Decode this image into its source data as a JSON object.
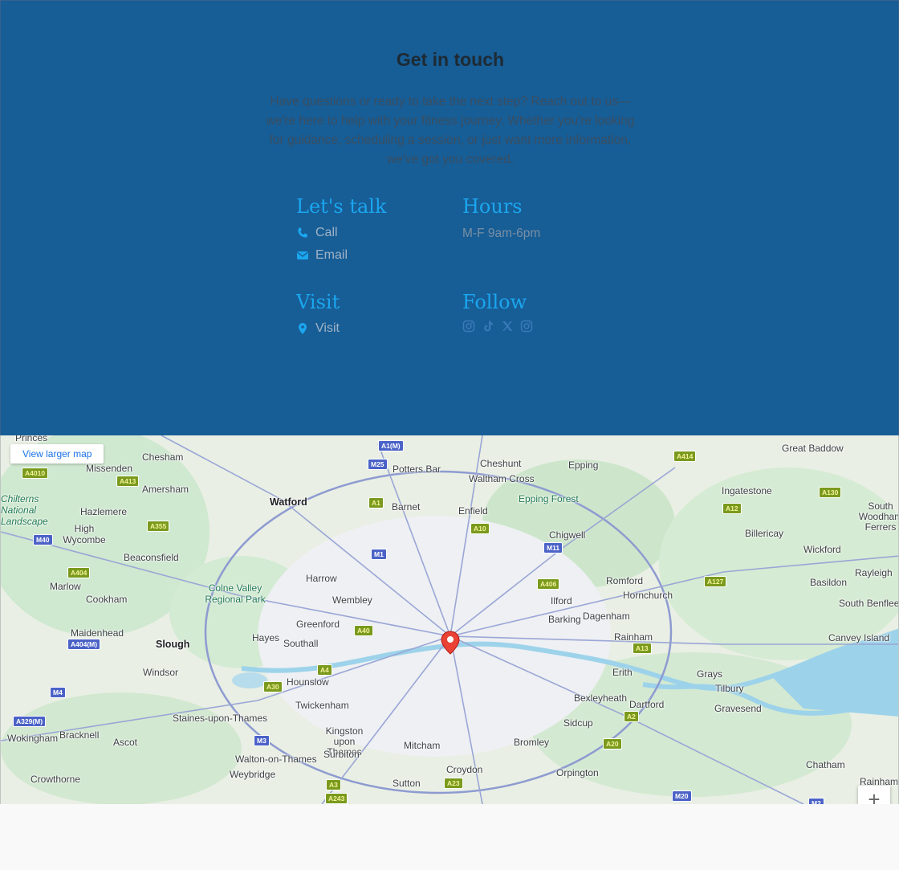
{
  "contact": {
    "title": "Get in touch",
    "intro": "Have questions or ready to take the next step? Reach out to us—we're here to help with your fitness journey. Whether you're looking for guidance, scheduling a session, or just want more information, we've got you covered.",
    "lets_talk": {
      "heading": "Let's talk",
      "call": "Call",
      "email": "Email"
    },
    "hours": {
      "heading": "Hours",
      "text": "M-F 9am-6pm"
    },
    "visit": {
      "heading": "Visit",
      "label": "Visit"
    },
    "follow": {
      "heading": "Follow",
      "icons": [
        "instagram-icon",
        "tiktok-icon",
        "x-icon",
        "instagram-icon"
      ]
    }
  },
  "map": {
    "larger_map": "View larger map",
    "zoom_in": "+",
    "places": [
      "Princes",
      "Chesham",
      "Missenden",
      "Amersham",
      "Potters Bar",
      "Cheshunt",
      "Epping",
      "Great Baddow",
      "Waltham Cross",
      "Watford",
      "Barnet",
      "Enfield",
      "Epping Forest",
      "Ingatestone",
      "Chilterns National Landscape",
      "Hazlemere",
      "High Wycombe",
      "Chigwell",
      "Billericay",
      "South Woodham Ferrers",
      "Beaconsfield",
      "Wickford",
      "Rayleigh",
      "Marlow",
      "Harrow",
      "Colne Valley Regional Park",
      "Romford",
      "Hornchurch",
      "Basildon",
      "Cookham",
      "Wembley",
      "Ilford",
      "South Benfleet",
      "Maidenhead",
      "Greenford",
      "Barking",
      "Dagenham",
      "Hayes",
      "Southall",
      "Rainham",
      "Canvey Island",
      "Slough",
      "Windsor",
      "Hounslow",
      "Erith",
      "Grays",
      "Tilbury",
      "Bexleyheath",
      "Dartford",
      "Gravesend",
      "Twickenham",
      "Staines-upon-Thames",
      "Wokingham",
      "Bracknell",
      "Ascot",
      "Kingston upon Thames",
      "Surbiton",
      "Mitcham",
      "Sidcup",
      "Bromley",
      "Walton-on-Thames",
      "Weybridge",
      "Croydon",
      "Orpington",
      "Chatham",
      "Crowthorne",
      "Sutton",
      "Rainham"
    ],
    "roads": [
      "A1(M)",
      "M25",
      "A4010",
      "A413",
      "A414",
      "A1",
      "A10",
      "A12",
      "A130",
      "A355",
      "M40",
      "M1",
      "M11",
      "A404",
      "A406",
      "A127",
      "A40",
      "A13",
      "A404(M)",
      "M4",
      "A30",
      "A4",
      "A2",
      "A329(M)",
      "M3",
      "A20",
      "A3",
      "A243",
      "A23",
      "M20",
      "M2"
    ]
  }
}
